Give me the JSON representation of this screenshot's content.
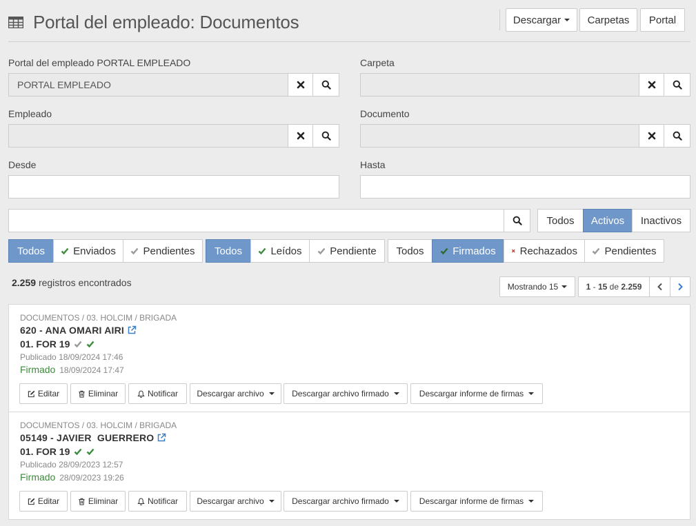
{
  "header": {
    "title": "Portal del empleado: Documentos",
    "buttons": {
      "download": "Descargar",
      "folders": "Carpetas",
      "portal": "Portal"
    }
  },
  "form": {
    "portal_label": "Portal del empleado PORTAL EMPLEADO",
    "portal_value": "PORTAL EMPLEADO",
    "folder_label": "Carpeta",
    "folder_value": "",
    "employee_label": "Empleado",
    "employee_value": "",
    "document_label": "Documento",
    "document_value": "",
    "from_label": "Desde",
    "from_value": "",
    "to_label": "Hasta",
    "to_value": ""
  },
  "search": {
    "value": "",
    "active_filter": {
      "all": "Todos",
      "active": "Activos",
      "inactive": "Inactivos",
      "selected": "Activos"
    }
  },
  "filters": {
    "sent": {
      "all": "Todos",
      "sent": "Enviados",
      "pending": "Pendientes",
      "selected": "Todos"
    },
    "read": {
      "all": "Todos",
      "read": "Leídos",
      "pending": "Pendiente",
      "selected": "Todos"
    },
    "signed": {
      "all": "Todos",
      "signed": "Firmados",
      "rejected": "Rechazados",
      "pending": "Pendientes",
      "selected": "Firmados"
    }
  },
  "results": {
    "count": "2.259",
    "count_suffix": "registros encontrados",
    "showing": "Mostrando 15",
    "range_start": "1",
    "range_end": "15",
    "range_of": "de",
    "total": "2.259"
  },
  "records": [
    {
      "breadcrumb": "DOCUMENTOS / 03. HOLCIM / BRIGADA",
      "employee": "620 - ANA OMARI AIRI",
      "document": "01. FOR 19",
      "published_label": "Publicado",
      "published_date": "18/09/2024 17:46",
      "signed_label": "Firmado",
      "signed_date": "18/09/2024 17:47"
    },
    {
      "breadcrumb": "DOCUMENTOS / 03. HOLCIM / BRIGADA",
      "employee": "05149 - JAVIER  GUERRERO",
      "document": "01. FOR 19",
      "published_label": "Publicado",
      "published_date": "28/09/2023 12:57",
      "signed_label": "Firmado",
      "signed_date": "28/09/2023 19:26"
    }
  ],
  "actions": {
    "edit": "Editar",
    "delete": "Eliminar",
    "notify": "Notificar",
    "download_file": "Descargar archivo",
    "download_signed": "Descargar archivo firmado",
    "download_report": "Descargar informe de firmas"
  },
  "colors": {
    "accent": "#6f97c9",
    "signed_green": "#3c8a3c",
    "link_blue": "#3b7fc4"
  },
  "icons": [
    "table-icon",
    "clear-x-icon",
    "search-icon",
    "check-icon",
    "reject-x-icon",
    "external-link-icon",
    "edit-icon",
    "trash-icon",
    "bell-icon",
    "chevron-left-icon",
    "chevron-right-icon"
  ]
}
